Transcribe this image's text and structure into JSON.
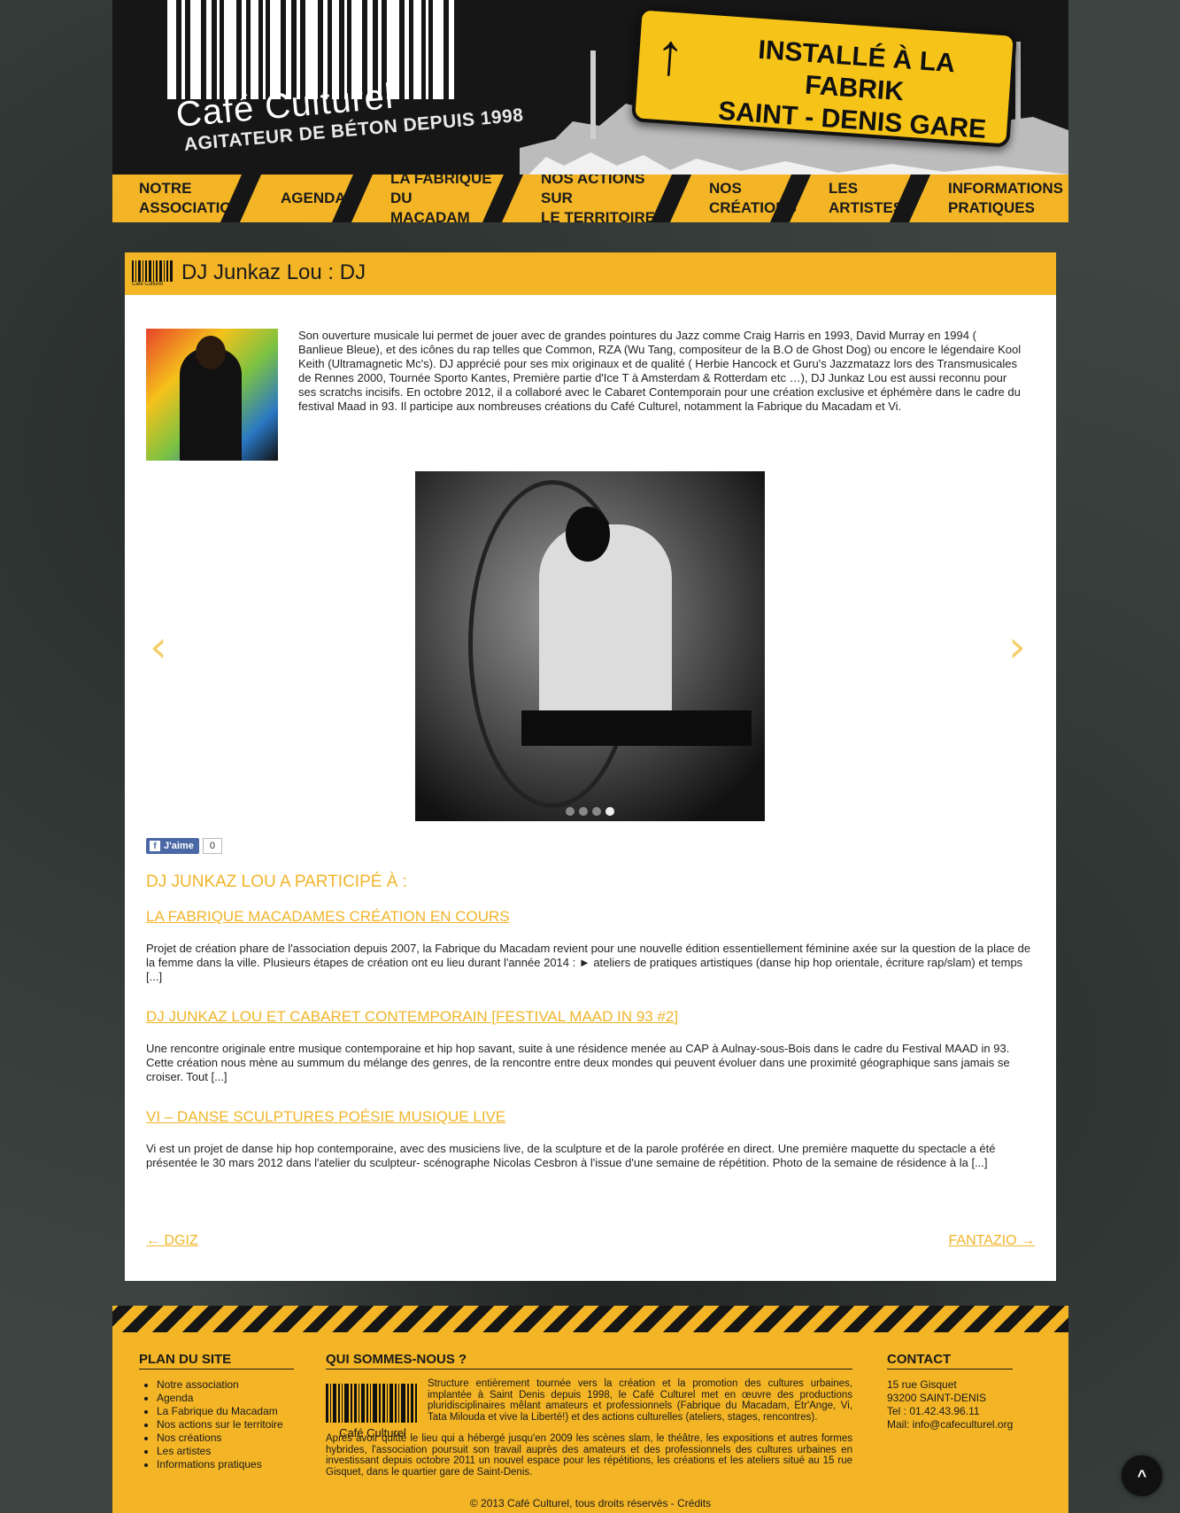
{
  "header": {
    "logo_name": "Café Culturel",
    "logo_tagline": "AGITATEUR DE BÉTON DEPUIS 1998",
    "sign_arrow": "↑",
    "sign_line1": "INSTALLÉ À LA FABRIK",
    "sign_line2": "SAINT - DENIS GARE"
  },
  "nav": [
    {
      "label1": "NOTRE",
      "label2": "ASSOCIATION"
    },
    {
      "label1": "AGENDA",
      "label2": ""
    },
    {
      "label1": "LA FABRIQUE DU",
      "label2": "MACADAM"
    },
    {
      "label1": "NOS ACTIONS SUR",
      "label2": "LE TERRITOIRE"
    },
    {
      "label1": "NOS",
      "label2": "CRÉATIONS"
    },
    {
      "label1": "LES",
      "label2": "ARTISTES"
    },
    {
      "label1": "INFORMATIONS",
      "label2": "PRATIQUES"
    }
  ],
  "page": {
    "title": "DJ Junkaz Lou : DJ",
    "title_brand": "Café Culturel",
    "bio": "Son ouverture musicale lui permet de jouer avec de grandes pointures du Jazz comme Craig Harris en 1993, David Murray en 1994 ( Banlieue Bleue), et des icônes du rap telles que Common, RZA (Wu Tang, compositeur de la B.O de Ghost Dog) ou encore le légendaire Kool Keith (Ultramagnetic Mc's). DJ apprécié pour ses mix originaux et de qualité ( Herbie Hancock et Guru's Jazzmatazz lors des Transmusicales de Rennes 2000, Tournée Sporto Kantes, Première partie d'Ice T à Amsterdam & Rotterdam etc …), DJ Junkaz Lou est aussi reconnu pour ses scratchs incisifs. En octobre 2012, il a collaboré avec le Cabaret Contemporain pour une création exclusive et éphémère dans le cadre du festival Maad in 93. Il participe aux nombreuses créations du Café Culturel, notamment la Fabrique du Macadam et Vi.",
    "slider_prev": "‹",
    "slider_next": "›",
    "slider_count": 4,
    "slider_active": 4,
    "like_label": "J'aime",
    "like_count": "0",
    "participated_heading": "DJ JUNKAZ LOU A PARTICIPÉ À :",
    "related": [
      {
        "title": "LA FABRIQUE MACADAMES CRÉATION EN COURS",
        "desc": "Projet de création phare de l'association depuis 2007, la Fabrique du Macadam revient pour une nouvelle édition essentiellement féminine axée sur la question de la place de la femme dans la ville. Plusieurs étapes de création ont eu lieu durant l'année 2014 : ► ateliers de pratiques artistiques (danse hip hop orientale, écriture rap/slam) et temps [...]"
      },
      {
        "title": "DJ JUNKAZ LOU ET CABARET CONTEMPORAIN [FESTIVAL MAAD IN 93 #2]",
        "desc": "Une rencontre originale entre musique contemporaine et hip hop savant, suite à une résidence menée au CAP à Aulnay-sous-Bois dans le cadre du Festival MAAD in 93. Cette création nous mène au summum du mélange des genres, de la rencontre entre deux mondes qui peuvent évoluer dans une proximité géographique sans jamais se croiser. Tout [...]"
      },
      {
        "title": "VI – DANSE SCULPTURES POÉSIE MUSIQUE LIVE",
        "desc": "Vi est un projet de danse hip hop contemporaine, avec des musiciens live, de la sculpture et de la parole proférée en direct.   Une première maquette du spectacle a été présentée le 30 mars 2012 dans l'atelier du sculpteur- scénographe Nicolas Cesbron à l'issue d'une semaine de répétition. Photo de la semaine de résidence à la [...]"
      }
    ],
    "prev_link": "← DGIZ",
    "next_link": "FANTAZIO →"
  },
  "footer": {
    "sitemap_heading": "PLAN DU SITE",
    "sitemap_items": [
      "Notre association",
      "Agenda",
      "La Fabrique du Macadam",
      "Nos actions sur le territoire",
      "Nos créations",
      "Les artistes",
      "Informations pratiques"
    ],
    "about_heading": "QUI SOMMES-NOUS ?",
    "about_brand": "Café Culturel",
    "about_p1_a": "Structure entièrement tournée vers la création et la promotion des cultures urbaines, implantée à Saint Denis depuis 1998, le Café Culturel met en œuvre des productions pluridisciplinaires mêlant amateurs et professionnels (",
    "about_link1": "Fabrique du Macadam",
    "about_sep1": ", ",
    "about_link2": "Etr'Ange",
    "about_sep2": ", ",
    "about_link3": "Vi",
    "about_sep3": ", ",
    "about_link4": "Tata Milouda et vive la Liberté!",
    "about_p1_b": ") et des actions culturelles (ateliers, stages, rencontres).",
    "about_p2": "Après avoir quitté le lieu qui a hébergé jusqu'en 2009 les scènes slam, le théâtre, les expositions et autres formes hybrides, l'association poursuit son travail auprès des amateurs et des professionnels des cultures urbaines en investissant depuis octobre 2011 un nouvel espace pour les répétitions, les créations et les ateliers situé au 15 rue Gisquet, dans le quartier gare de Saint-Denis.",
    "contact_heading": "CONTACT",
    "contact_address": "15 rue Gisquet",
    "contact_city": "93200 SAINT-DENIS",
    "contact_tel": "Tel : 01.42.43.96.11",
    "contact_mail_label": "Mail: ",
    "contact_mail": "info@cafeculturel.org",
    "copyright": "© 2013 Café Culturel, tous droits réservés - ",
    "credits": "Crédits",
    "back_to_top": "^"
  }
}
